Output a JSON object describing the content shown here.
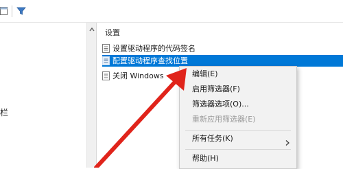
{
  "toolbar": {
    "icons": [
      "window-icon",
      "filter-icon"
    ]
  },
  "left_pane": {
    "partial_label": "栏"
  },
  "right_pane": {
    "column_header": "设置",
    "items": [
      {
        "label": "设置驱动程序的代码签名",
        "icon": "policy-icon",
        "selected": false
      },
      {
        "label": "配置驱动程序查找位置",
        "icon": "policy-icon",
        "selected": true
      },
      {
        "label": "关闭 Windows",
        "icon": "policy-icon",
        "selected": false
      }
    ]
  },
  "context_menu": {
    "items": [
      {
        "label": "编辑(E)",
        "enabled": true
      },
      {
        "label": "启用筛选器(F)",
        "enabled": true
      },
      {
        "label": "筛选器选项(O)...",
        "enabled": true
      },
      {
        "label": "重新应用筛选器(E)",
        "enabled": false
      },
      {
        "label": "所有任务(K)",
        "enabled": true,
        "submenu": true
      },
      {
        "label": "帮助(H)",
        "enabled": true
      }
    ]
  },
  "colors": {
    "selection": "#0078d7",
    "annotation_arrow": "#e0241b",
    "menu_background": "#f2f2f2"
  }
}
